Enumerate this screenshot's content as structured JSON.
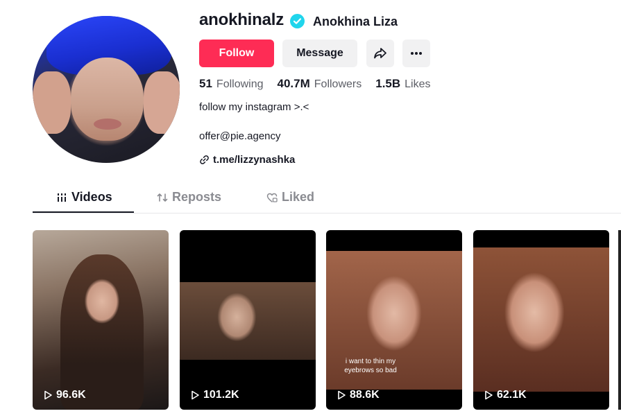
{
  "profile": {
    "username": "anokhinalz",
    "display_name": "Anokhina Liza",
    "bio": "follow my instagram >.<",
    "email": "offer@pie.agency",
    "link": "t.me/lizzynashka"
  },
  "actions": {
    "follow_label": "Follow",
    "message_label": "Message"
  },
  "stats": {
    "following": {
      "value": "51",
      "label": "Following"
    },
    "followers": {
      "value": "40.7M",
      "label": "Followers"
    },
    "likes": {
      "value": "1.5B",
      "label": "Likes"
    }
  },
  "tabs": [
    {
      "label": "Videos",
      "active": true
    },
    {
      "label": "Reposts",
      "active": false
    },
    {
      "label": "Liked",
      "active": false
    }
  ],
  "videos": [
    {
      "views": "96.6K",
      "caption": ""
    },
    {
      "views": "101.2K",
      "caption": ""
    },
    {
      "views": "88.6K",
      "caption": "i want to thin my eyebrows so bad"
    },
    {
      "views": "62.1K",
      "caption": ""
    }
  ],
  "colors": {
    "accent": "#fe2c55",
    "verified": "#20d5ec",
    "text": "#161823",
    "muted": "#8a8b91"
  }
}
